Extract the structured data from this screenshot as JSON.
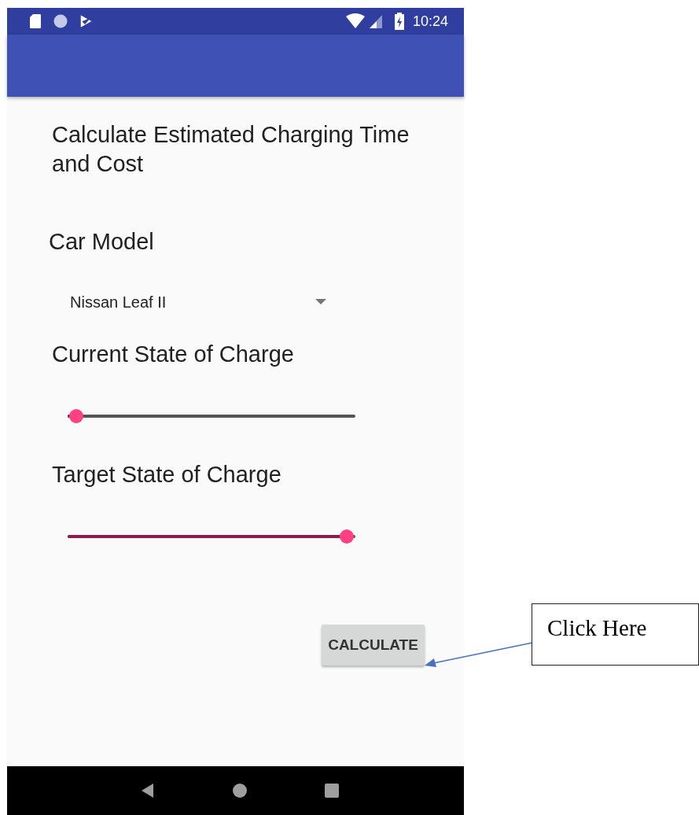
{
  "status_bar": {
    "time": "10:24"
  },
  "title": "Calculate Estimated Charging Time and Cost",
  "car_model": {
    "label": "Car Model",
    "value": "Nissan Leaf II"
  },
  "sliders": [
    {
      "label": "Current State of Charge",
      "level": 0.03
    },
    {
      "label": "Target State of Charge",
      "level": 0.97
    }
  ],
  "button": "CALCULATE",
  "callout": "Click Here"
}
